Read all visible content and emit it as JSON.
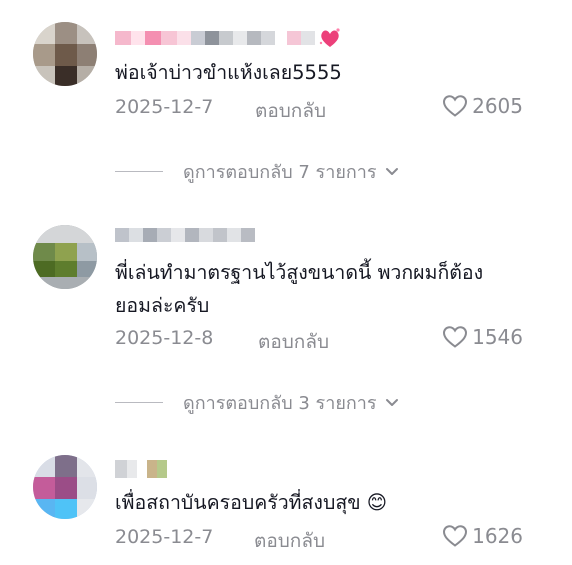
{
  "comments": [
    {
      "text": "พ่อเจ้าบ่าวขำแห้งเลย5555",
      "date": "2025-12-7",
      "reply_label": "ตอบกลับ",
      "likes": "2605",
      "view_replies": "ดูการตอบกลับ 7 รายการ"
    },
    {
      "text_line1": "พี่เล่นทำมาตรฐานไว้สูงขนาดนี้ พวกผมก็ต้อง",
      "text_line2": "ยอมล่ะครับ",
      "date": "2025-12-8",
      "reply_label": "ตอบกลับ",
      "likes": "1546",
      "view_replies": "ดูการตอบกลับ 3 รายการ"
    },
    {
      "text": "เพื่อสถาบันครอบครัวที่สงบสุข 😊",
      "date": "2025-12-7",
      "reply_label": "ตอบกลับ",
      "likes": "1626"
    }
  ],
  "colors": {
    "text": "#161823",
    "meta": "#8a8b91",
    "divider": "#b9bac0"
  },
  "icons": [
    "heart-outline-icon",
    "chevron-down-icon",
    "sparkling-heart-emoji"
  ]
}
